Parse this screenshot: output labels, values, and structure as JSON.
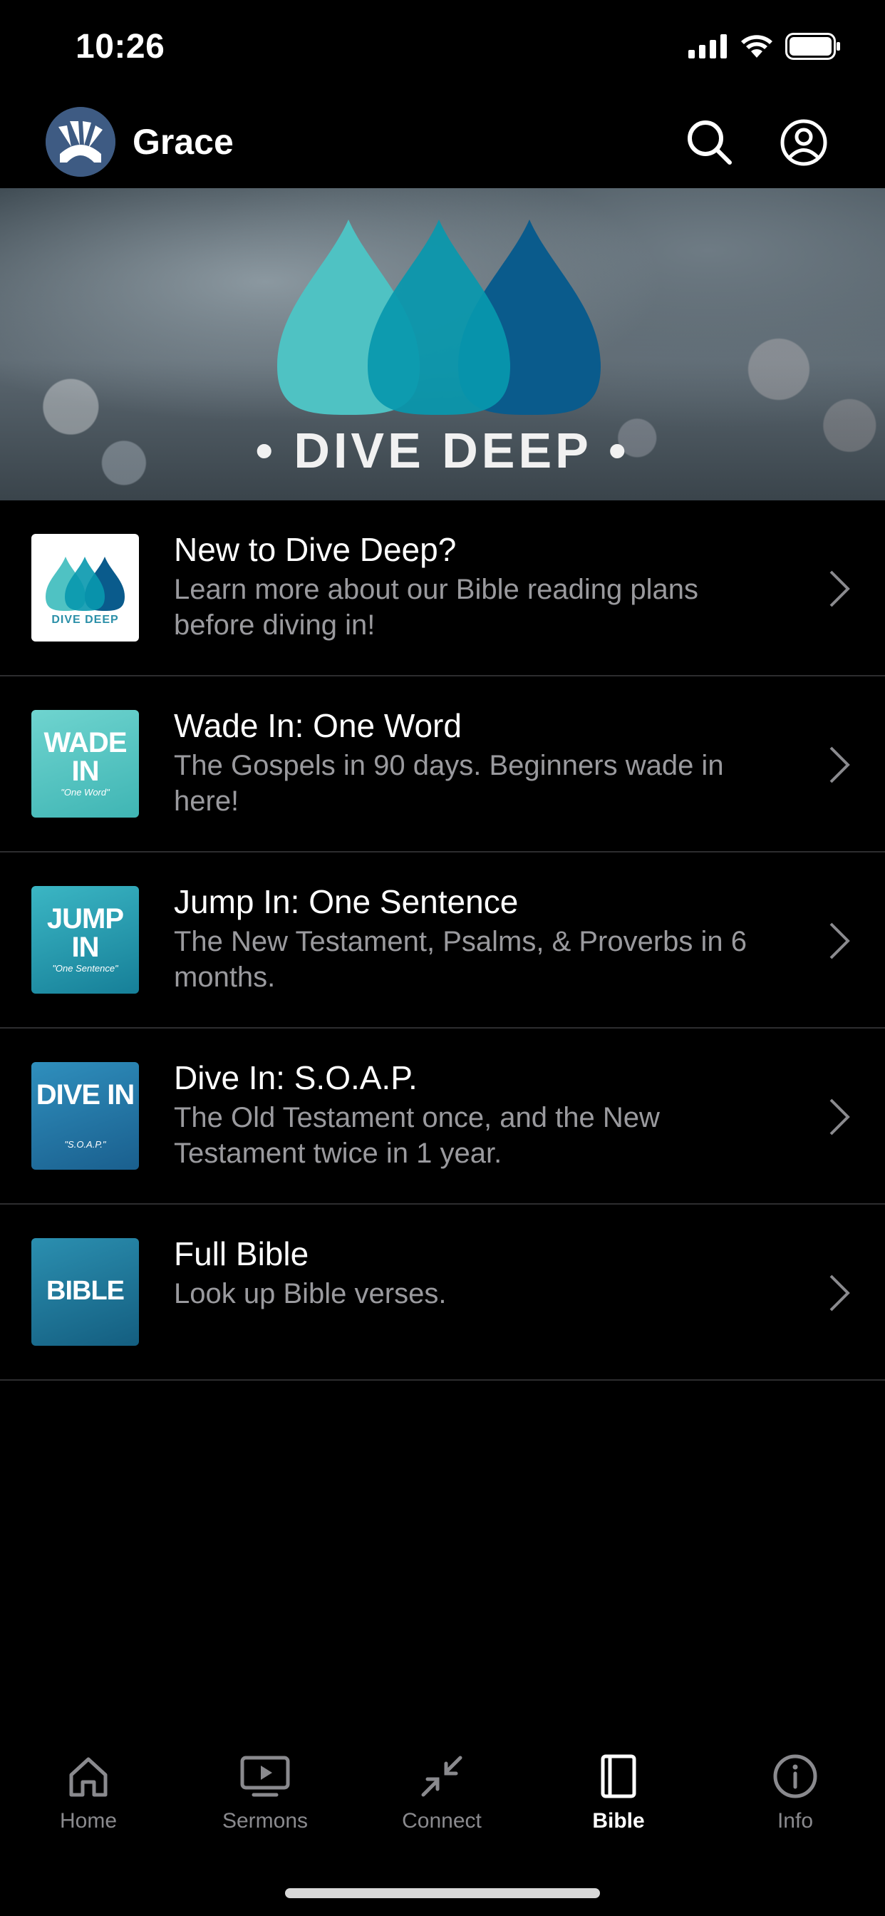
{
  "status_bar": {
    "time": "10:26"
  },
  "header": {
    "app_name": "Grace",
    "icons": [
      "search-icon",
      "account-icon"
    ]
  },
  "hero": {
    "title": "• DIVE DEEP •",
    "colors": [
      "#4fc2c3",
      "#0898ae",
      "#0a5b8c"
    ]
  },
  "plans": [
    {
      "title": "New to Dive Deep?",
      "description": "Learn more about our Bible reading plans before diving in!",
      "thumb_label": "DIVE DEEP",
      "thumb_sub": ""
    },
    {
      "title": "Wade In: One Word",
      "description": "The Gospels in 90 days. Beginners wade in here!",
      "thumb_label": "WADE IN",
      "thumb_sub": "\"One Word\""
    },
    {
      "title": "Jump In: One Sentence",
      "description": "The New Testament, Psalms, & Proverbs in 6 months.",
      "thumb_label": "JUMP IN",
      "thumb_sub": "\"One Sentence\""
    },
    {
      "title": "Dive In: S.O.A.P.",
      "description": "The Old Testament once, and the New Testament twice in 1 year.",
      "thumb_label": "DIVE IN",
      "thumb_sub": "\"S.O.A.P.\""
    },
    {
      "title": "Full Bible",
      "description": "Look up Bible verses.",
      "thumb_label": "BIBLE",
      "thumb_sub": ""
    }
  ],
  "tabs": [
    {
      "label": "Home",
      "icon": "home-icon",
      "active": false
    },
    {
      "label": "Sermons",
      "icon": "tv-icon",
      "active": false
    },
    {
      "label": "Connect",
      "icon": "connect-icon",
      "active": false
    },
    {
      "label": "Bible",
      "icon": "book-icon",
      "active": true
    },
    {
      "label": "Info",
      "icon": "info-icon",
      "active": false
    }
  ]
}
